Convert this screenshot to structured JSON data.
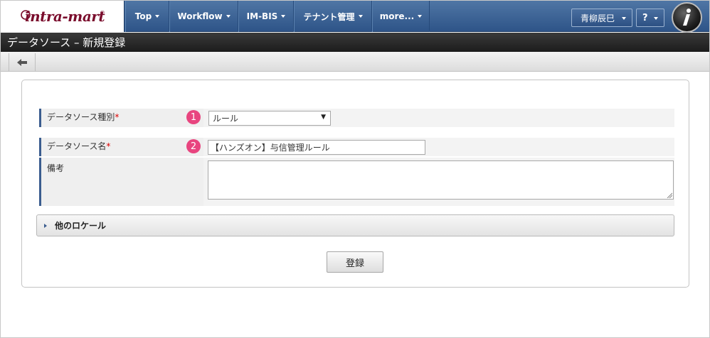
{
  "brand": {
    "logo_text": "intra-mart",
    "logo_reg": "®"
  },
  "nav": {
    "items": [
      {
        "label": "Top"
      },
      {
        "label": "Workflow"
      },
      {
        "label": "IM-BIS"
      },
      {
        "label": "テナント管理"
      },
      {
        "label": "more..."
      }
    ],
    "user_name": "青柳辰巳",
    "help_label": "?"
  },
  "page": {
    "title": "データソース – 新規登録"
  },
  "form": {
    "type_field": {
      "label": "データソース種別",
      "required_mark": "*",
      "marker": "1",
      "value": "ルール"
    },
    "name_field": {
      "label": "データソース名",
      "required_mark": "*",
      "marker": "2",
      "value": "【ハンズオン】与信管理ルール"
    },
    "note_field": {
      "label": "備考",
      "value": ""
    },
    "locale_section": "他のロケール",
    "submit_label": "登録"
  },
  "colors": {
    "nav_bg": "#3d6396",
    "title_bg": "#262626",
    "marker": "#e8457f",
    "accent": "#3b5d8f"
  }
}
